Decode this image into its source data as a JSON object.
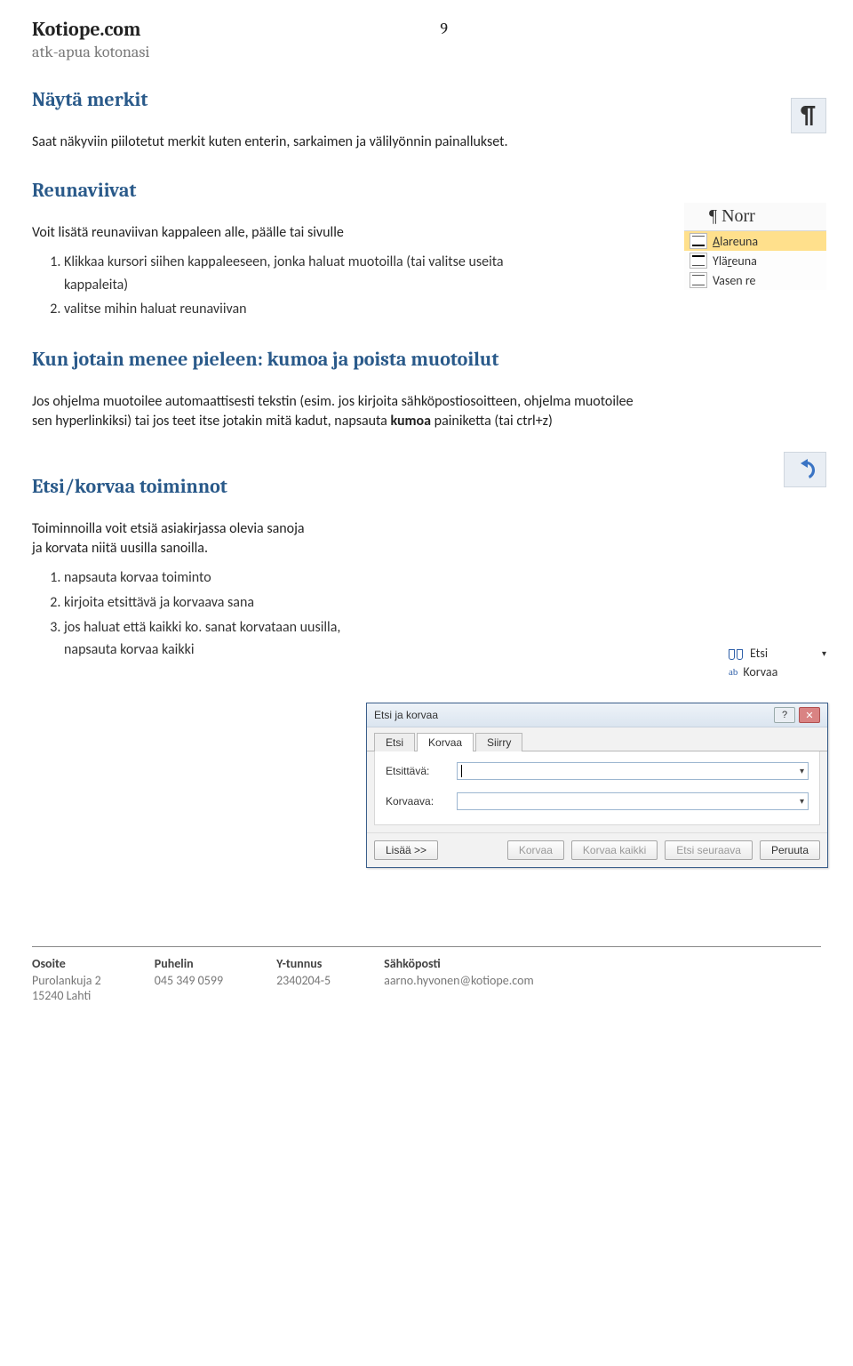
{
  "header": {
    "site": "Kotiope.com",
    "tagline": "atk-apua kotonasi",
    "page": "9"
  },
  "s1": {
    "heading": "Näytä merkit",
    "body": "Saat näkyviin piilotetut merkit kuten enterin, sarkaimen ja välilyönnin painallukset."
  },
  "s2": {
    "heading": "Reunaviivat",
    "intro": "Voit lisätä reunaviivan kappaleen alle, päälle tai sivulle",
    "steps": [
      "Klikkaa kursori siihen kappaleeseen, jonka haluat muotoilla (tai valitse useita kappaleita)",
      "valitse mihin haluat reunaviivan"
    ],
    "menu": {
      "normal": "¶ Norr",
      "items": [
        {
          "label_pre": "",
          "u": "A",
          "label_post": "lareuna",
          "sel": true
        },
        {
          "label_pre": "Ylä",
          "u": "r",
          "label_post": "euna",
          "sel": false
        },
        {
          "label_pre": "Vasen re",
          "u": "",
          "label_post": "",
          "sel": false
        }
      ]
    }
  },
  "s3": {
    "heading": "Kun jotain menee pieleen: kumoa ja poista muotoilut",
    "body_a": "Jos ohjelma muotoilee automaattisesti tekstin (esim. jos kirjoita sähköpostiosoitteen, ohjelma muotoilee sen hyperlinkiksi) tai jos teet itse jotakin mitä kadut, napsauta ",
    "body_bold": "kumoa",
    "body_b": " painiketta (tai ctrl+z)"
  },
  "s4": {
    "heading": "Etsi/korvaa toiminnot",
    "intro": "Toiminnoilla voit etsiä asiakirjassa olevia sanoja ja korvata niitä uusilla sanoilla.",
    "steps": [
      "napsauta korvaa toiminto",
      "kirjoita etsittävä ja korvaava sana",
      "jos haluat että kaikki ko. sanat korvataan uusilla, napsauta korvaa kaikki"
    ],
    "findmenu": {
      "find": "Etsi",
      "arrow": "▾",
      "replace": "Korvaa"
    },
    "dialog": {
      "title": "Etsi ja korvaa",
      "tabs": [
        "Etsi",
        "Korvaa",
        "Siirry"
      ],
      "active_tab": 1,
      "field1": "Etsittävä:",
      "field2": "Korvaava:",
      "btn_more": "Lisää >>",
      "btns": [
        "Korvaa",
        "Korvaa kaikki",
        "Etsi seuraava",
        "Peruuta"
      ]
    }
  },
  "footer": {
    "cols": [
      {
        "h": "Osoite",
        "v1": "Purolankuja 2",
        "v2": "15240 Lahti"
      },
      {
        "h": "Puhelin",
        "v1": "045 349 0599",
        "v2": ""
      },
      {
        "h": "Y-tunnus",
        "v1": "2340204-5",
        "v2": ""
      },
      {
        "h": "Sähköposti",
        "v1": "aarno.hyvonen@kotiope.com",
        "v2": ""
      }
    ]
  }
}
